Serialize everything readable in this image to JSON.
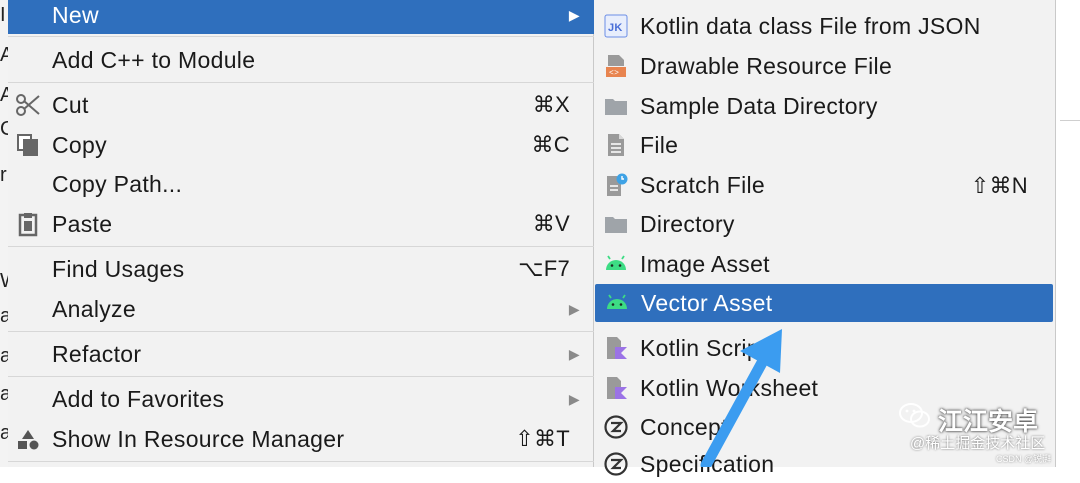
{
  "editor_fragments": [
    "I",
    "A",
    "A",
    "C",
    "r",
    "W",
    "a",
    "a",
    "a",
    "a"
  ],
  "menu": {
    "items": [
      {
        "label": "New",
        "shortcut": "",
        "submenu": true,
        "selected": true,
        "icon": ""
      },
      {
        "label": "Add C++ to Module",
        "shortcut": "",
        "submenu": false,
        "icon": ""
      },
      {
        "label": "Cut",
        "shortcut": "⌘X",
        "submenu": false,
        "icon": "scissors-icon"
      },
      {
        "label": "Copy",
        "shortcut": "⌘C",
        "submenu": false,
        "icon": "copy-icon"
      },
      {
        "label": "Copy Path...",
        "shortcut": "",
        "submenu": false,
        "icon": ""
      },
      {
        "label": "Paste",
        "shortcut": "⌘V",
        "submenu": false,
        "icon": "clipboard-icon"
      },
      {
        "label": "Find Usages",
        "shortcut": "⌥F7",
        "submenu": false,
        "icon": ""
      },
      {
        "label": "Analyze",
        "shortcut": "",
        "submenu": true,
        "icon": ""
      },
      {
        "label": "Refactor",
        "shortcut": "",
        "submenu": true,
        "icon": ""
      },
      {
        "label": "Add to Favorites",
        "shortcut": "",
        "submenu": true,
        "icon": ""
      },
      {
        "label": "Show In Resource Manager",
        "shortcut": "⇧⌘T",
        "submenu": false,
        "icon": "shapes-icon"
      }
    ]
  },
  "submenu": {
    "items": [
      {
        "label": "Kotlin data class File from JSON",
        "shortcut": "",
        "icon": "kotlin-json-icon"
      },
      {
        "label": "Drawable Resource File",
        "shortcut": "",
        "icon": "drawable-file-icon"
      },
      {
        "label": "Sample Data Directory",
        "shortcut": "",
        "icon": "folder-icon"
      },
      {
        "label": "File",
        "shortcut": "",
        "icon": "file-icon"
      },
      {
        "label": "Scratch File",
        "shortcut": "⇧⌘N",
        "icon": "scratch-file-icon"
      },
      {
        "label": "Directory",
        "shortcut": "",
        "icon": "folder-icon"
      },
      {
        "label": "Image Asset",
        "shortcut": "",
        "icon": "android-icon"
      },
      {
        "label": "Vector Asset",
        "shortcut": "",
        "icon": "android-icon",
        "selected": true
      },
      {
        "label": "Kotlin Script",
        "shortcut": "",
        "icon": "kotlin-file-icon"
      },
      {
        "label": "Kotlin Worksheet",
        "shortcut": "",
        "icon": "kotlin-file-icon"
      },
      {
        "label": "Concept",
        "shortcut": "",
        "icon": "concept-icon"
      },
      {
        "label": "Specification",
        "shortcut": "",
        "icon": "concept-icon"
      }
    ]
  },
  "watermark": {
    "brand": "江江安卓",
    "sub": "@稀土掘金技术社区",
    "csdn": "CSDN @锐湃"
  },
  "colors": {
    "selection": "#2f6fbd",
    "menu_bg": "#f2f2f2",
    "android_green": "#3ddc84",
    "arrow": "#3b9cf0"
  }
}
